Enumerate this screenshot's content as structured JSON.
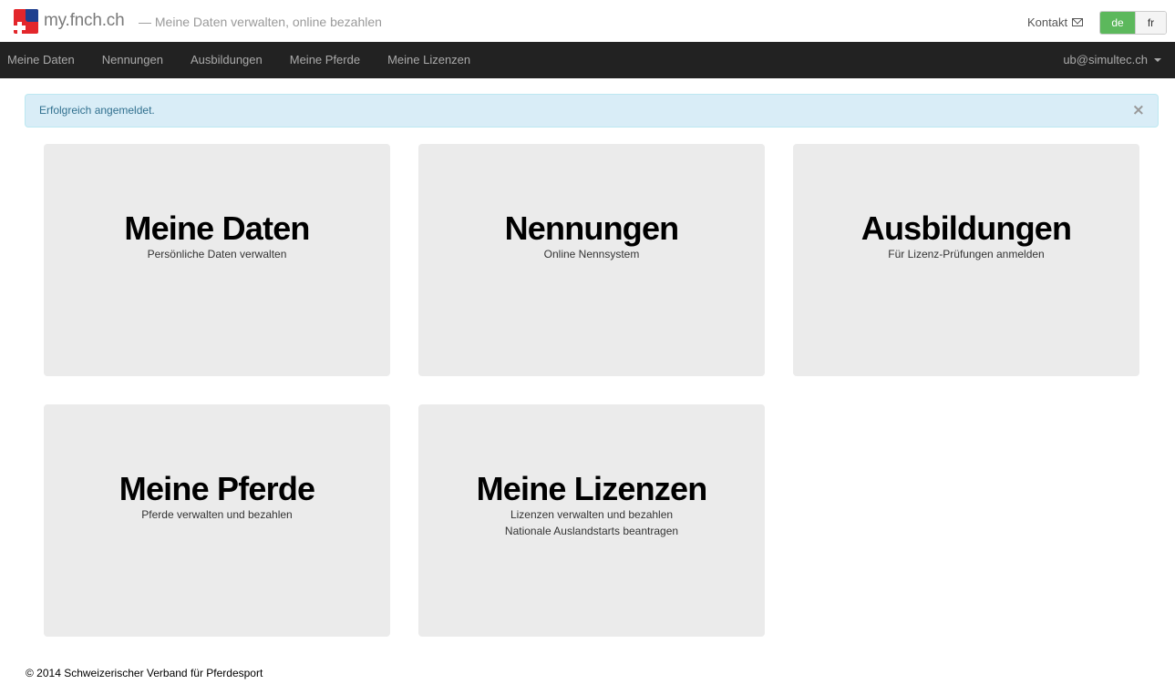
{
  "header": {
    "brand": "my.fnch.ch",
    "tagline": "— Meine Daten verwalten, online bezahlen",
    "contact_label": "Kontakt",
    "languages": [
      "de",
      "fr"
    ],
    "active_language": "de"
  },
  "nav": {
    "items": [
      "Meine Daten",
      "Nennungen",
      "Ausbildungen",
      "Meine Pferde",
      "Meine Lizenzen"
    ],
    "user": "ub@simultec.ch"
  },
  "alert": {
    "text": "Erfolgreich angemeldet.",
    "close": "×"
  },
  "tiles": [
    {
      "title": "Meine Daten",
      "subtitle": "Persönliche Daten verwalten",
      "subtitle2": ""
    },
    {
      "title": "Nennungen",
      "subtitle": "Online Nennsystem",
      "subtitle2": ""
    },
    {
      "title": "Ausbildungen",
      "subtitle": "Für Lizenz-Prüfungen anmelden",
      "subtitle2": ""
    },
    {
      "title": "Meine Pferde",
      "subtitle": "Pferde verwalten und bezahlen",
      "subtitle2": ""
    },
    {
      "title": "Meine Lizenzen",
      "subtitle": "Lizenzen verwalten und bezahlen",
      "subtitle2": "Nationale Auslandstarts beantragen"
    }
  ],
  "footer": {
    "text": "© 2014 Schweizerischer Verband für Pferdesport"
  },
  "colors": {
    "navbar_bg": "#222222",
    "alert_bg": "#d9edf7",
    "tile_bg": "#ebebeb",
    "active_lang": "#5cb85c"
  },
  "icons": [
    "swiss-flag-logo-icon",
    "envelope-icon",
    "caret-down-icon",
    "close-icon"
  ]
}
